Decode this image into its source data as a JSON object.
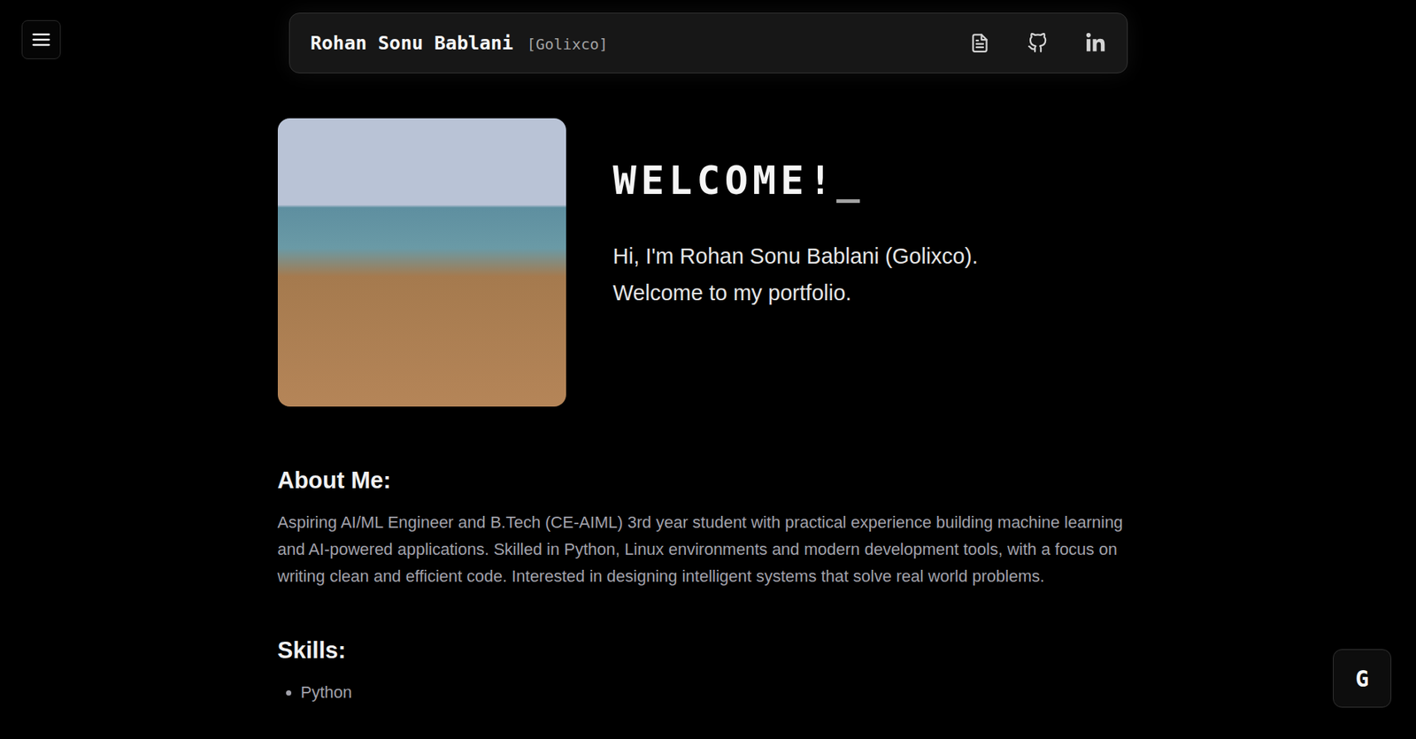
{
  "header": {
    "name": "Rohan Sonu Bablani",
    "handle": "[Golixco]"
  },
  "hero": {
    "title": "WELCOME!",
    "cursor": "_",
    "lines": [
      "Hi, I'm Rohan Sonu Bablani (Golixco).",
      "Welcome to my portfolio."
    ]
  },
  "about": {
    "heading": "About Me:",
    "text": "Aspiring AI/ML Engineer and B.Tech (CE-AIML) 3rd year student with practical experience building machine learning and AI-powered applications. Skilled in Python, Linux environments and modern development tools, with a focus on writing clean and efficient code. Interested in designing intelligent systems that solve real world problems."
  },
  "skills": {
    "heading": "Skills:",
    "items": [
      "Python"
    ]
  },
  "fab": {
    "label": "G"
  }
}
